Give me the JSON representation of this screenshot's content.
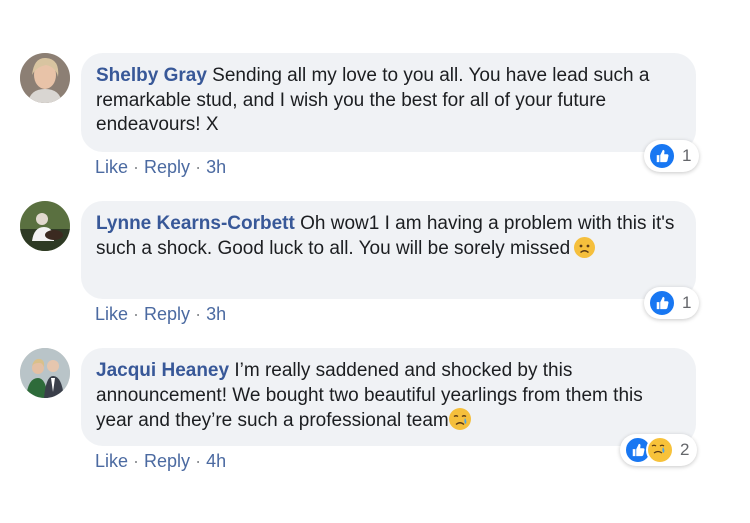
{
  "comments": [
    {
      "author": "Shelby Gray",
      "text": "Sending all my love to you all. You have lead such a remarkable stud, and I wish you the best for all of your future endeavours! X",
      "like": "Like",
      "reply": "Reply",
      "time": "3h",
      "reaction_count": "1",
      "reactions": [
        "like-icon"
      ],
      "avatar": "avatar-photo"
    },
    {
      "author": "Lynne Kearns-Corbett",
      "text": "Oh wow1 I am having a problem with this it's such a shock. Good luck to all. You will be sorely missed",
      "emoji": "sad-face-emoji",
      "like": "Like",
      "reply": "Reply",
      "time": "3h",
      "reaction_count": "1",
      "reactions": [
        "like-icon"
      ],
      "avatar": "avatar-photo"
    },
    {
      "author": "Jacqui Heaney",
      "text": "I’m really saddened and shocked by this announcement! We bought two beautiful yearlings from them this year and they’re such a professional team",
      "emoji": "crying-face-emoji",
      "like": "Like",
      "reply": "Reply",
      "time": "4h",
      "reaction_count": "2",
      "reactions": [
        "like-icon",
        "sad-icon"
      ],
      "avatar": "avatar-photo"
    }
  ],
  "separator": "·",
  "colors": {
    "author": "#385898",
    "bubble": "#f0f2f5",
    "like_blue": "#1877f2",
    "action_link": "#4b6aa1"
  }
}
